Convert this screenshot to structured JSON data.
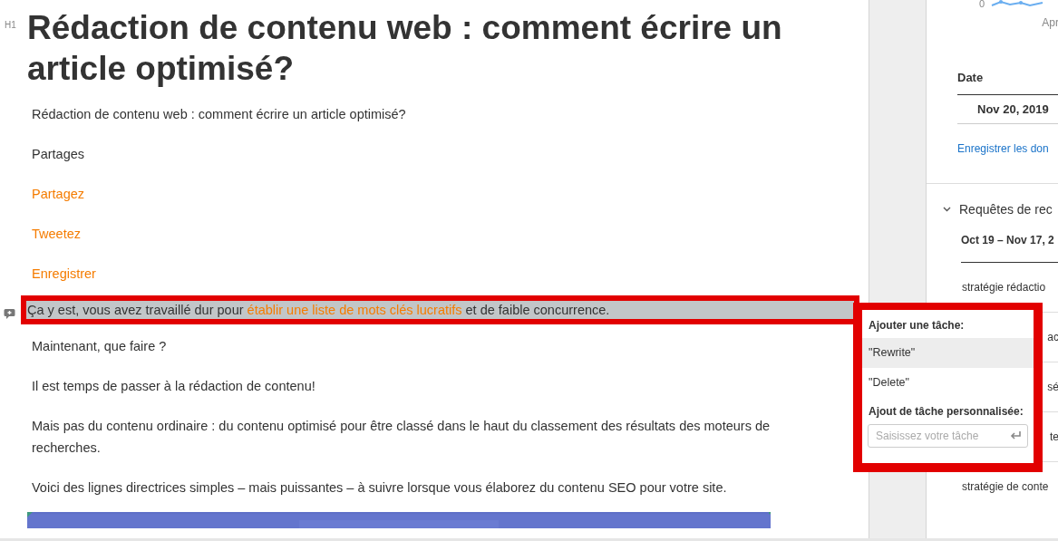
{
  "article": {
    "heading_tag": "H1",
    "title": "Rédaction de contenu web : comment écrire un article optimisé?",
    "paragraphs": [
      {
        "kind": "text",
        "text": "Rédaction de contenu web : comment écrire un article optimisé?",
        "selected": false
      },
      {
        "kind": "text",
        "text": "Partages",
        "selected": false
      },
      {
        "kind": "link",
        "text": "Partagez",
        "selected": false
      },
      {
        "kind": "link",
        "text": "Tweetez",
        "selected": false
      },
      {
        "kind": "link",
        "text": "Enregistrer",
        "selected": false
      },
      {
        "kind": "text",
        "text": "Ça y est, vous avez travaillé dur pour ",
        "link": "établir une liste de mots clés lucratifs",
        "after": " et de faible concurrence.",
        "selected": true
      },
      {
        "kind": "text",
        "text": "Maintenant, que faire ?",
        "selected": false
      },
      {
        "kind": "text",
        "text": "Il est temps de passer à la rédaction de contenu!",
        "selected": false
      },
      {
        "kind": "text",
        "text": "Mais pas du contenu ordinaire : du contenu optimisé pour être classé  dans le haut du classement des résultats des moteurs de recherches.",
        "selected": false
      },
      {
        "kind": "text",
        "text": "Voici des lignes directrices simples – mais puissantes – à suivre lorsque vous élaborez du contenu SEO pour votre site.",
        "selected": false
      }
    ]
  },
  "task_popup": {
    "title": "Ajouter une tâche:",
    "options": [
      {
        "label": "\"Rewrite\"",
        "selected": true
      },
      {
        "label": "\"Delete\"",
        "selected": false
      }
    ],
    "custom_title": "Ajout de tâche personnalisée:",
    "placeholder": "Saisissez votre tâche"
  },
  "side_panel": {
    "chart_tick": "0",
    "chart_month": "Apr",
    "date_header": "Date",
    "date": "Nov 20, 2019",
    "save_link": "Enregistrer les don",
    "section_title": "Requêtes de rec",
    "expanded": true,
    "range": "Oct 19 – Nov 17, 2",
    "rows": [
      {
        "text": "stratégie rédactio",
        "kind": "query"
      },
      {
        "text": "ac",
        "kind": "fragment"
      },
      {
        "text": "sé",
        "kind": "fragment"
      },
      {
        "text": "te",
        "kind": "fragment"
      },
      {
        "text": "stratégie de conte",
        "kind": "query"
      }
    ]
  }
}
